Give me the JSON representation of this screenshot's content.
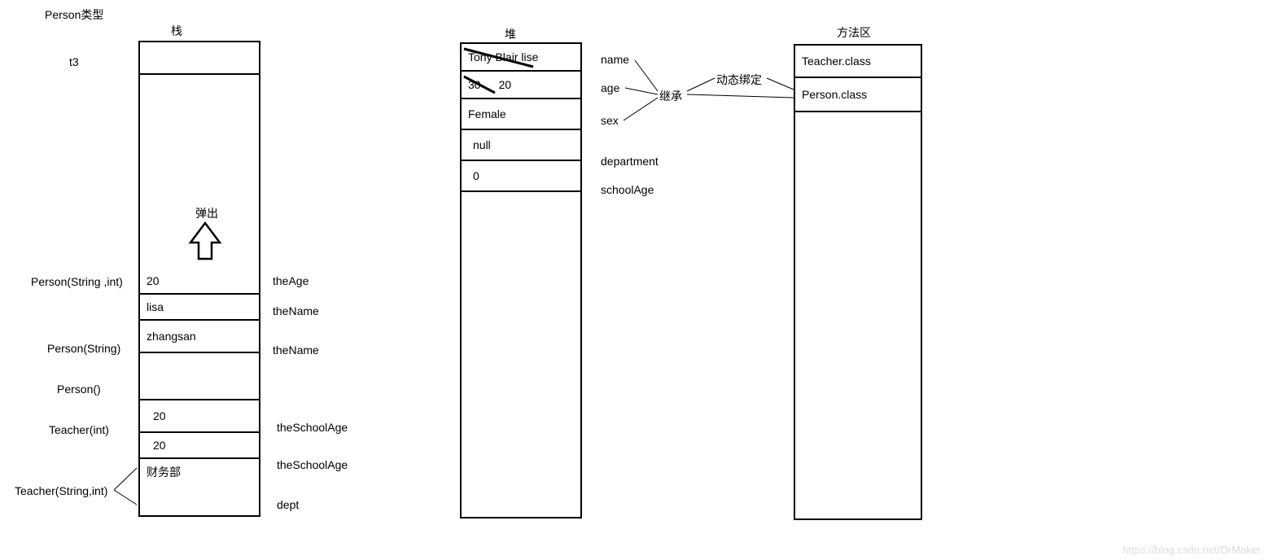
{
  "labels": {
    "person_type": "Person类型",
    "stack_title": "栈",
    "heap_title": "堆",
    "method_area_title": "方法区",
    "t3": "t3",
    "popup": "弹出",
    "inherit": "继承",
    "dynamic_binding": "动态绑定",
    "watermark": "https://blog.csdn.net/DrMaker"
  },
  "stack": {
    "left_labels": {
      "person_string_int": "Person(String ,int)",
      "person_string": "Person(String)",
      "person_empty": "Person()",
      "teacher_int": "Teacher(int)",
      "teacher_string_int": "Teacher(String,int)"
    },
    "right_labels": {
      "theAge": "theAge",
      "theName1": "theName",
      "theName2": "theName",
      "theSchoolAge1": "theSchoolAge",
      "theSchoolAge2": "theSchoolAge",
      "dept": "dept"
    },
    "cells": {
      "c20_1": "20",
      "lisa": "lisa",
      "zhangsan": "zhangsan",
      "c20_2": "20",
      "c20_3": "20",
      "finance": "财务部"
    }
  },
  "heap": {
    "right_labels": {
      "name": "name",
      "age": "age",
      "sex": "sex",
      "department": "department",
      "schoolAge": "schoolAge"
    },
    "cells": {
      "name_val": "Tony Blair  lise",
      "age_old": "30",
      "age_new": "20",
      "female": "Female",
      "null_val": "null",
      "zero": "0"
    }
  },
  "method_area": {
    "teacher_class": "Teacher.class",
    "person_class": "Person.class"
  }
}
